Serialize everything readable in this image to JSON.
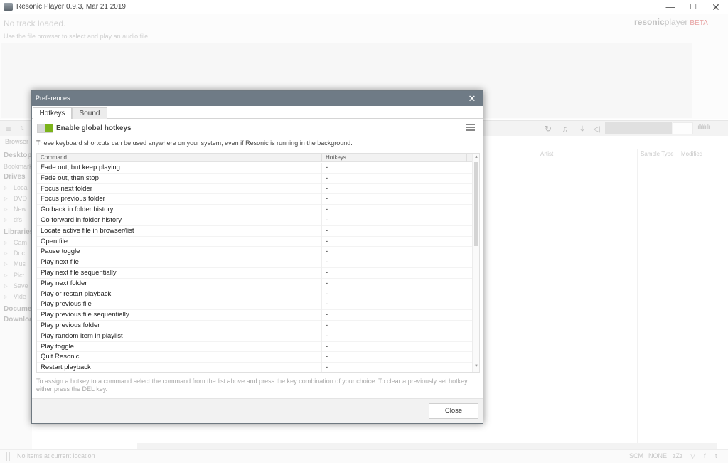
{
  "app": {
    "title": "Resonic Player 0.9.3, Mar 21 2019",
    "window_controls": {
      "minimize": "—",
      "maximize": "☐",
      "close": "✕"
    },
    "brand": {
      "name": "resonic",
      "name_suffix": "player",
      "badge": "BETA"
    }
  },
  "track": {
    "title": "No track loaded.",
    "hint": "Use the file browser to select and play an audio file."
  },
  "sidebar": {
    "tab": "Browser",
    "items": [
      {
        "label": "Desktop",
        "kind": "head"
      },
      {
        "label": "Bookmarks",
        "kind": "sub-plain"
      },
      {
        "label": "Drives",
        "kind": "head"
      },
      {
        "label": "Loca",
        "kind": "sub"
      },
      {
        "label": "DVD",
        "kind": "sub"
      },
      {
        "label": "New",
        "kind": "sub"
      },
      {
        "label": "dfs",
        "kind": "sub"
      },
      {
        "label": "Libraries",
        "kind": "head"
      },
      {
        "label": "Cam",
        "kind": "sub"
      },
      {
        "label": "Doc",
        "kind": "sub"
      },
      {
        "label": "Mus",
        "kind": "sub"
      },
      {
        "label": "Pict",
        "kind": "sub"
      },
      {
        "label": "Save",
        "kind": "sub"
      },
      {
        "label": "Vide",
        "kind": "sub"
      },
      {
        "label": "Documer",
        "kind": "head"
      },
      {
        "label": "Downloa",
        "kind": "head"
      }
    ]
  },
  "list": {
    "columns": [
      "Artist",
      "Sample Type",
      "Modified"
    ]
  },
  "status": {
    "text": "No items at current location",
    "right": [
      "SCM",
      "NONE",
      "zZz"
    ]
  },
  "dialog": {
    "title": "Preferences",
    "close_glyph": "✕",
    "tabs": [
      {
        "label": "Hotkeys",
        "active": true
      },
      {
        "label": "Sound",
        "active": false
      }
    ],
    "global_hotkeys": {
      "label": "Enable global hotkeys",
      "enabled": true
    },
    "description": "These keyboard shortcuts can be used anywhere on your system, even if Resonic is running in the background.",
    "table": {
      "headers": [
        "Command",
        "Hotkeys"
      ],
      "rows": [
        {
          "command": "Fade out, but keep playing",
          "hotkey": "-"
        },
        {
          "command": "Fade out, then stop",
          "hotkey": "-"
        },
        {
          "command": "Focus next folder",
          "hotkey": "-"
        },
        {
          "command": "Focus previous folder",
          "hotkey": "-"
        },
        {
          "command": "Go back in folder history",
          "hotkey": "-"
        },
        {
          "command": "Go forward in folder history",
          "hotkey": "-"
        },
        {
          "command": "Locate active file in browser/list",
          "hotkey": "-"
        },
        {
          "command": "Open file",
          "hotkey": "-"
        },
        {
          "command": "Pause toggle",
          "hotkey": "-"
        },
        {
          "command": "Play next file",
          "hotkey": "-"
        },
        {
          "command": "Play next file sequentially",
          "hotkey": "-"
        },
        {
          "command": "Play next folder",
          "hotkey": "-"
        },
        {
          "command": "Play or restart playback",
          "hotkey": "-"
        },
        {
          "command": "Play previous file",
          "hotkey": "-"
        },
        {
          "command": "Play previous file sequentially",
          "hotkey": "-"
        },
        {
          "command": "Play previous folder",
          "hotkey": "-"
        },
        {
          "command": "Play random item in playlist",
          "hotkey": "-"
        },
        {
          "command": "Play toggle",
          "hotkey": "-"
        },
        {
          "command": "Quit Resonic",
          "hotkey": "-"
        },
        {
          "command": "Restart playback",
          "hotkey": "-"
        }
      ]
    },
    "help": "To assign a hotkey to a command select the command from the list above and press the key combination of your choice. To clear a previously set hotkey either press the DEL key.",
    "close_label": "Close"
  },
  "colors": {
    "dialog_titlebar": "#6f7b86",
    "toggle_on": "#7bb31a",
    "brand_beta": "#e7a3a3"
  }
}
